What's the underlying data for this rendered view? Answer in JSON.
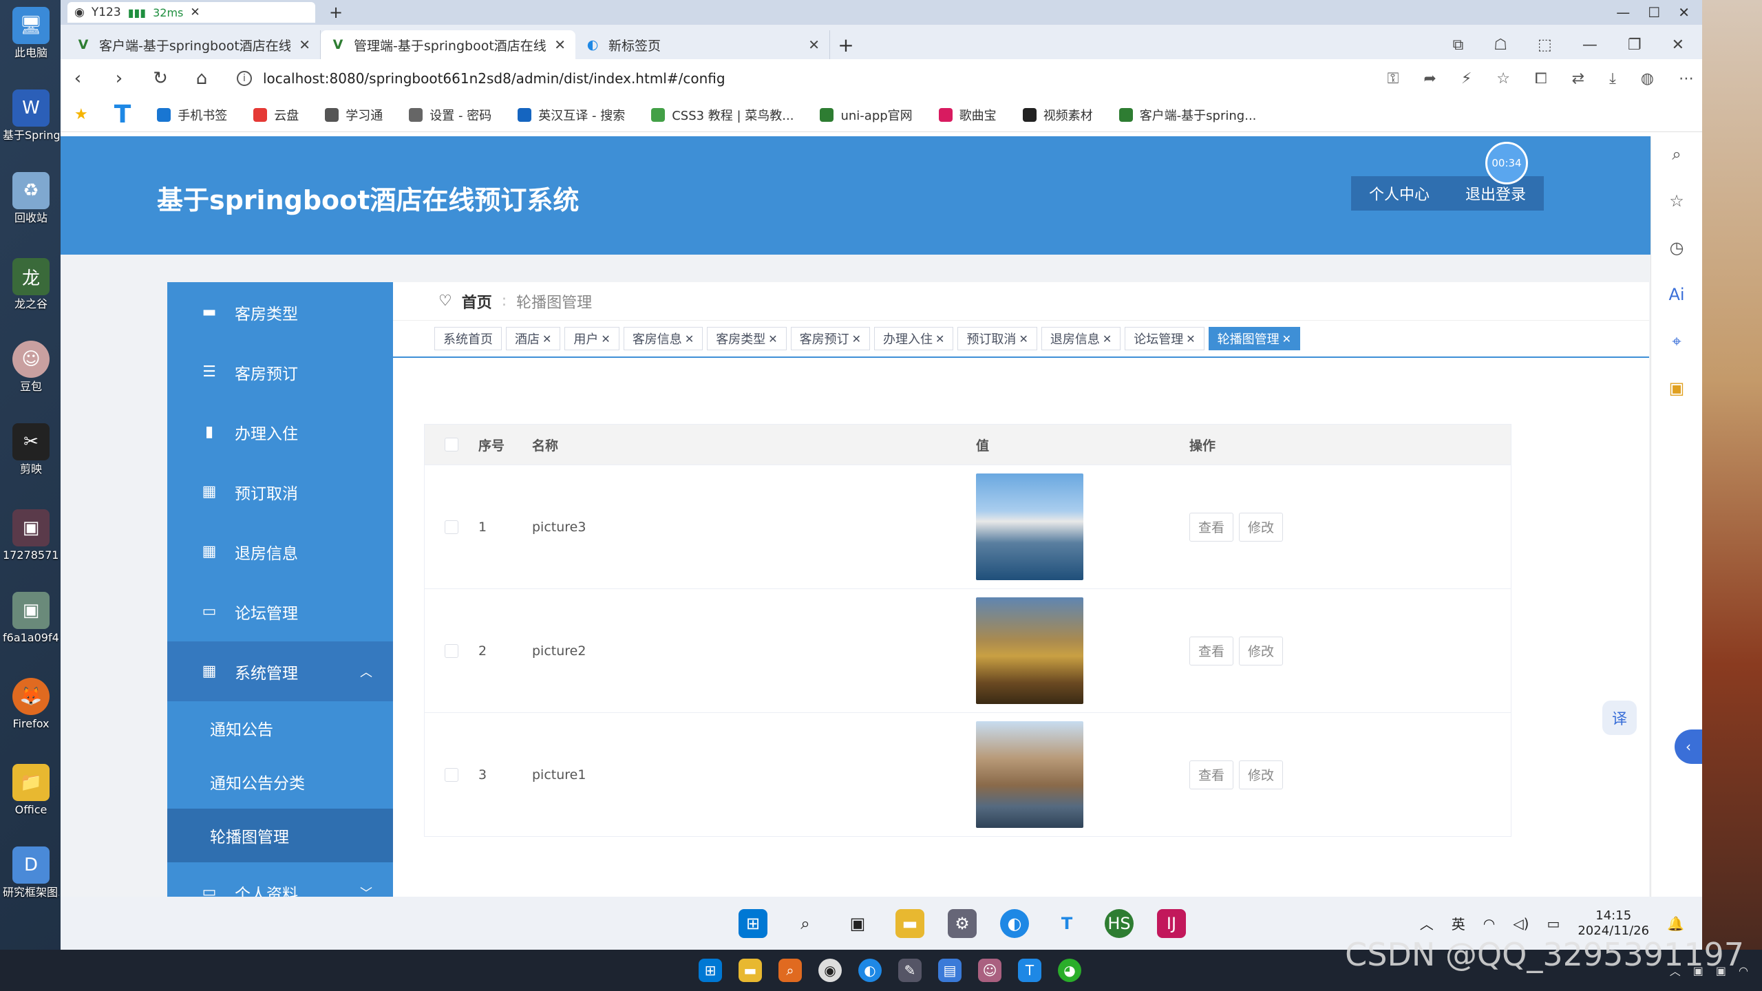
{
  "desktop": {
    "icons": [
      {
        "label": "此电脑",
        "icon": "computer-icon"
      },
      {
        "label": "基于SpringBo...",
        "icon": "word-icon"
      },
      {
        "label": "回收站",
        "icon": "recycle-bin-icon"
      },
      {
        "label": "龙之谷",
        "icon": "game-icon"
      },
      {
        "label": "豆包",
        "icon": "avatar-icon"
      },
      {
        "label": "剪映",
        "icon": "video-editor-icon"
      },
      {
        "label": "17278571...",
        "icon": "photo-icon"
      },
      {
        "label": "f6a1a09f4f...",
        "icon": "photo-icon"
      },
      {
        "label": "Firefox",
        "icon": "firefox-icon"
      },
      {
        "label": "Office",
        "icon": "folder-icon"
      },
      {
        "label": "研究框架图.eddx",
        "icon": "file-icon"
      }
    ]
  },
  "browser": {
    "mini_tab": {
      "title": "Y123",
      "ping": "32ms"
    },
    "tabs": [
      {
        "label": "客户端-基于springboot酒店在线",
        "active": false
      },
      {
        "label": "管理端-基于springboot酒店在线",
        "active": true
      },
      {
        "label": "新标签页",
        "active": false
      }
    ],
    "url": "localhost:8080/springboot661n2sd8/admin/dist/index.html#/config",
    "bookmarks": [
      {
        "label": "手机书签",
        "color": "#1976d2"
      },
      {
        "label": "云盘",
        "color": "#e53935"
      },
      {
        "label": "学习通",
        "color": "#555555"
      },
      {
        "label": "设置 - 密码",
        "color": "#666666"
      },
      {
        "label": "英汉互译 - 搜索",
        "color": "#1565c0"
      },
      {
        "label": "CSS3 教程 | 菜鸟教...",
        "color": "#43a047"
      },
      {
        "label": "uni-app官网",
        "color": "#2e7d32"
      },
      {
        "label": "歌曲宝",
        "color": "#d81b60"
      },
      {
        "label": "视频素材",
        "color": "#222222"
      },
      {
        "label": "客户端-基于spring...",
        "color": "#2e7d32"
      }
    ]
  },
  "app": {
    "title": "基于springboot酒店在线预订系统",
    "timer": "00:34",
    "header_buttons": {
      "profile": "个人中心",
      "logout": "退出登录"
    },
    "sidebar": {
      "items": [
        {
          "label": "客房类型",
          "icon": "bed-icon"
        },
        {
          "label": "客房预订",
          "icon": "list-icon"
        },
        {
          "label": "办理入住",
          "icon": "book-icon"
        },
        {
          "label": "预订取消",
          "icon": "grid-icon"
        },
        {
          "label": "退房信息",
          "icon": "grid-icon"
        },
        {
          "label": "论坛管理",
          "icon": "chat-icon"
        }
      ],
      "system": {
        "label": "系统管理",
        "icon": "grid-icon",
        "sub": [
          "通知公告",
          "通知公告分类",
          "轮播图管理"
        ]
      },
      "personal": {
        "label": "个人资料",
        "icon": "user-card-icon"
      }
    },
    "breadcrumb": {
      "home": "首页",
      "current": "轮播图管理"
    },
    "tags": [
      "系统首页",
      "酒店",
      "用户",
      "客房信息",
      "客房类型",
      "客房预订",
      "办理入住",
      "预订取消",
      "退房信息",
      "论坛管理",
      "轮播图管理"
    ],
    "table": {
      "headers": {
        "index": "序号",
        "name": "名称",
        "value": "值",
        "ops": "操作"
      },
      "rows": [
        {
          "index": "1",
          "name": "picture3"
        },
        {
          "index": "2",
          "name": "picture2"
        },
        {
          "index": "3",
          "name": "picture1"
        }
      ],
      "btn_view": "查看",
      "btn_edit": "修改"
    },
    "translate_label": "译"
  },
  "system": {
    "time": "14:15",
    "date": "2024/11/26",
    "ime": "英",
    "watermark": "CSDN @QQ_3295391197"
  }
}
